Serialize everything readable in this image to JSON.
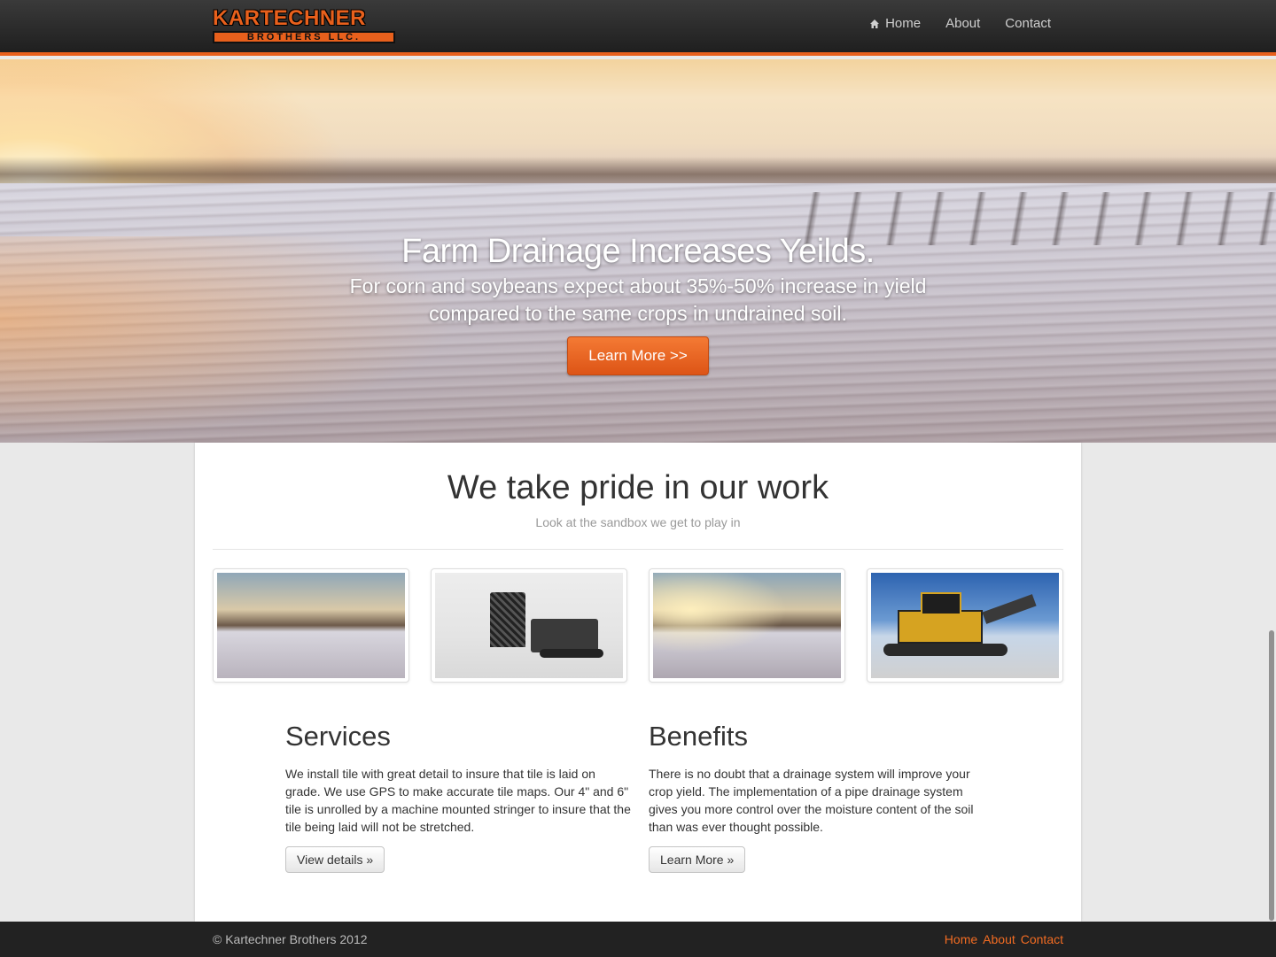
{
  "brand": {
    "logo_top": "KARTECHNER",
    "logo_bottom": "BROTHERS LLC.",
    "accent_color": "#e8601c"
  },
  "nav": {
    "items": [
      {
        "label": "Home",
        "icon": "home-icon"
      },
      {
        "label": "About"
      },
      {
        "label": "Contact"
      }
    ]
  },
  "hero": {
    "title": "Farm Drainage Increases Yeilds.",
    "subtitle_line1": "For corn and soybeans expect about 35%-50% increase in yield",
    "subtitle_line2": "compared to the same crops in undrained soil.",
    "button_label": "Learn More >>"
  },
  "main": {
    "title": "We take pride in our work",
    "subtitle": "Look at the sandbox we get to play in",
    "thumbnails": [
      {
        "icon": "field-sunset-image"
      },
      {
        "icon": "snow-machine-image"
      },
      {
        "icon": "field-sunrise-image"
      },
      {
        "icon": "excavator-image"
      }
    ],
    "services": {
      "title": "Services",
      "text": "We install tile with great detail to insure that tile is laid on grade. We use GPS to make accurate tile maps. Our 4\" and 6\" tile is unrolled by a machine mounted stringer to insure that the tile being laid will not be stretched.",
      "button_label": "View details »"
    },
    "benefits": {
      "title": "Benefits",
      "text": "There is no doubt that a drainage system will improve your crop yield. The implementation of a pipe drainage system gives you more control over the moisture content of the soil than was ever thought possible.",
      "button_label": "Learn More »"
    }
  },
  "footer": {
    "copyright": "© Kartechner Brothers 2012",
    "links": [
      "Home",
      "About",
      "Contact"
    ],
    "link_color": "#f26c22"
  }
}
